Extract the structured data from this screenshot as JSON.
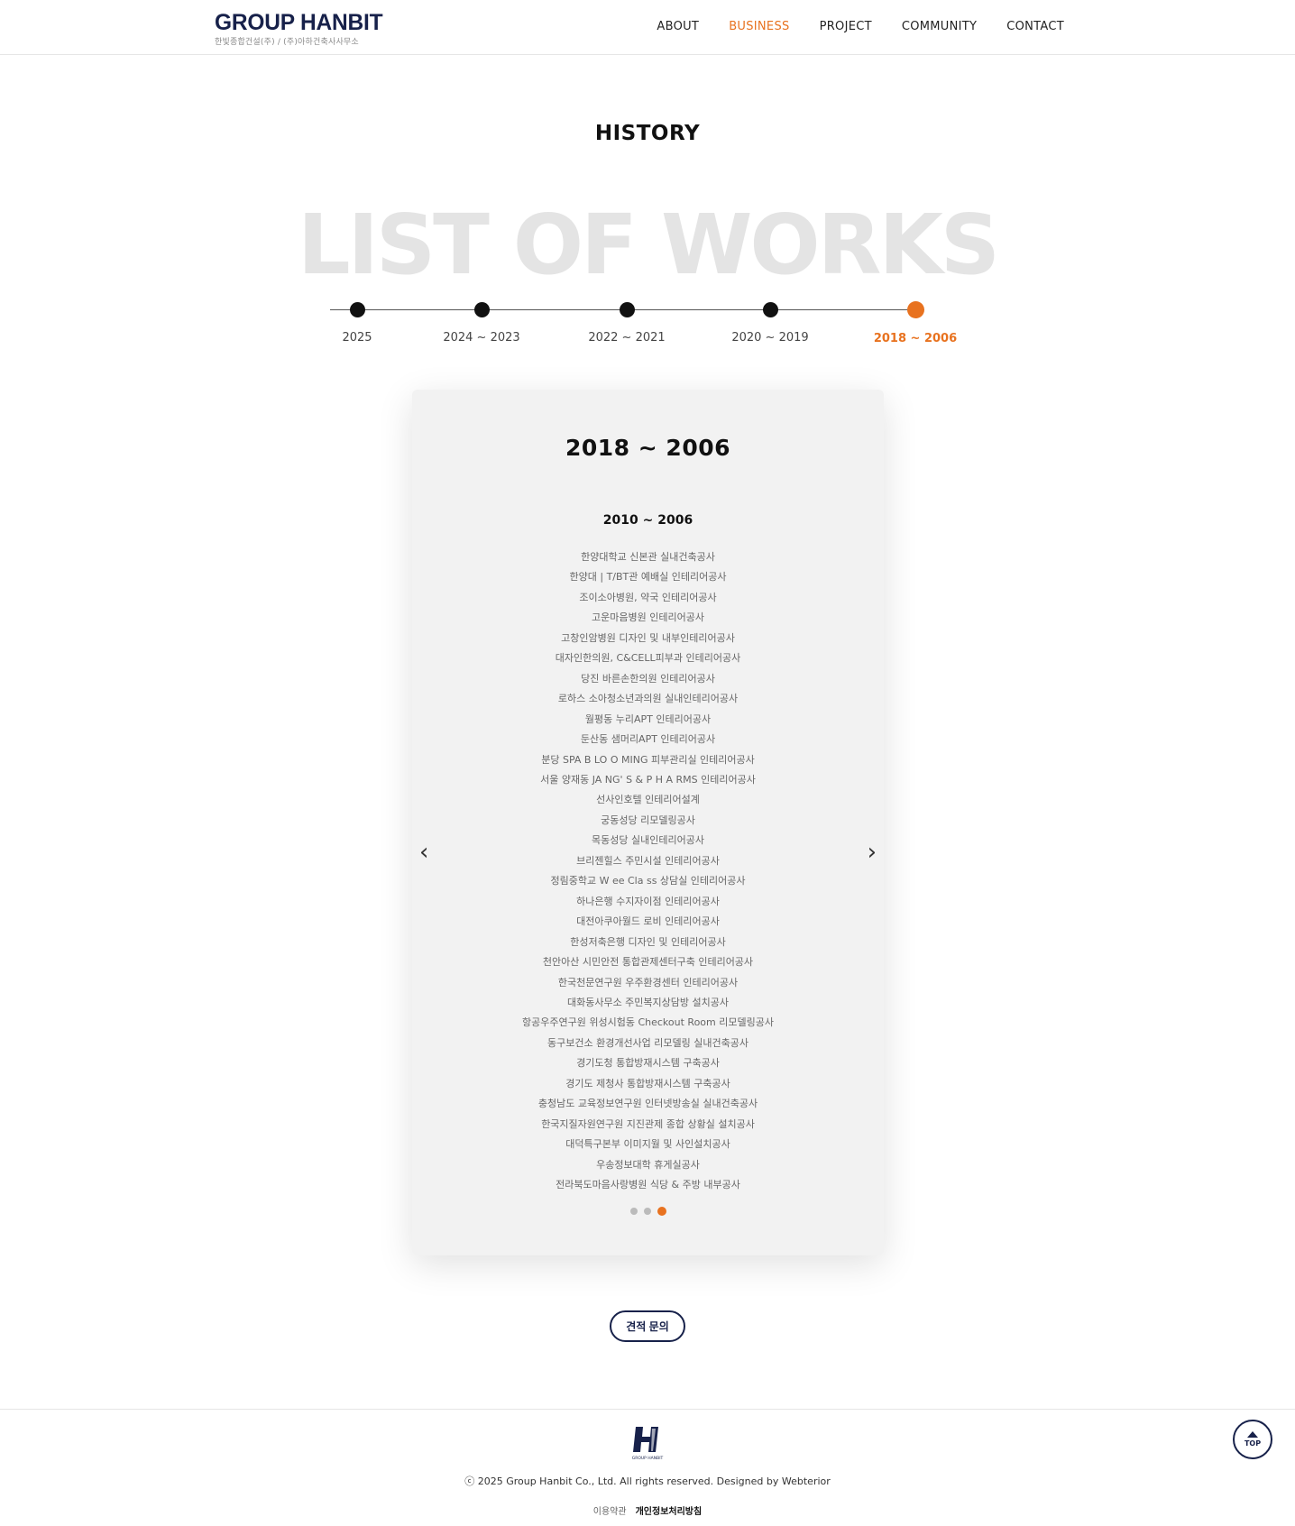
{
  "header": {
    "logo_main": "GROUP HANBIT",
    "logo_sub": "한빛종합건설(주) / (주)아하건축사사무소",
    "nav": [
      {
        "label": "ABOUT",
        "active": false
      },
      {
        "label": "BUSINESS",
        "active": true
      },
      {
        "label": "PROJECT",
        "active": false
      },
      {
        "label": "COMMUNITY",
        "active": false
      },
      {
        "label": "CONTACT",
        "active": false
      }
    ]
  },
  "page_title": "HISTORY",
  "watermark": "LIST OF WORKS",
  "timeline": [
    {
      "label": "2025",
      "active": false
    },
    {
      "label": "2024 ~ 2023",
      "active": false
    },
    {
      "label": "2022 ~ 2021",
      "active": false
    },
    {
      "label": "2020 ~ 2019",
      "active": false
    },
    {
      "label": "2018 ~ 2006",
      "active": true
    }
  ],
  "card": {
    "title": "2018 ~ 2006",
    "subtitle": "2010 ~ 2006",
    "prev_arrow": "‹",
    "next_arrow": "›",
    "works": [
      "한양대학교 신본관 실내건축공사",
      "한양대 | T/BT관 예배실 인테리어공사",
      "조이소아병원, 약국 인테리어공사",
      "고운마음병원 인테리어공사",
      "고창인암병원 디자인 및 내부인테리어공사",
      "대자인한의원, C&CELL피부과 인테리어공사",
      "당진 바른손한의원 인테리어공사",
      "로하스 소아청소년과의원 실내인테리어공사",
      "월평동 누리APT 인테리어공사",
      "둔산동 샘머리APT 인테리어공사",
      "분당 SPA B LO O MING 피부관리실 인테리어공사",
      "서울 양재동 JA NG' S & P H A RMS 인테리어공사",
      "선사인호텔 인테리어설계",
      "궁동성당 리모델링공사",
      "목동성당 실내인테리어공사",
      "브리젠힐스 주민시설 인테리어공사",
      "정림중학교 W ee Cla ss 상담실 인테리어공사",
      "하나은행 수지자이점 인테리어공사",
      "대전아쿠아월드 로비 인테리어공사",
      "한성저축은행 디자인 및 인테리어공사",
      "천안아산 시민안전 통합관제센터구축 인테리어공사",
      "한국천문연구원 우주환경센터 인테리어공사",
      "대화동사무소 주민복지상담방 설치공사",
      "항공우주연구원 위성시험동 Checkout Room 리모델링공사",
      "동구보건소 환경개선사업 리모델링 실내건축공사",
      "경기도청 통합방재시스템 구축공사",
      "경기도 제청사 통합방재시스템 구축공사",
      "충청남도 교육정보연구원 인터넷방송실 실내건축공사",
      "한국지질자원연구원 지진관제 종합 상황실 설치공사",
      "대덕특구본부 이미지월 및 사인설치공사",
      "우송정보대학 휴게실공사",
      "전라북도마음사랑병원 식당 & 주방 내부공사"
    ],
    "pagination": {
      "total": 3,
      "active_index": 2
    }
  },
  "quote_button": "견적 문의",
  "footer": {
    "copyright": "ⓒ 2025 Group Hanbit Co., Ltd. All rights reserved. Designed by Webterior",
    "links": [
      "이용약관",
      "개인정보처리방침"
    ],
    "top_label": "TOP",
    "logo_caption": "GROUP HANBIT"
  },
  "colors": {
    "accent": "#e8721f",
    "brand": "#17214a",
    "card_bg": "#f2f2f2"
  }
}
